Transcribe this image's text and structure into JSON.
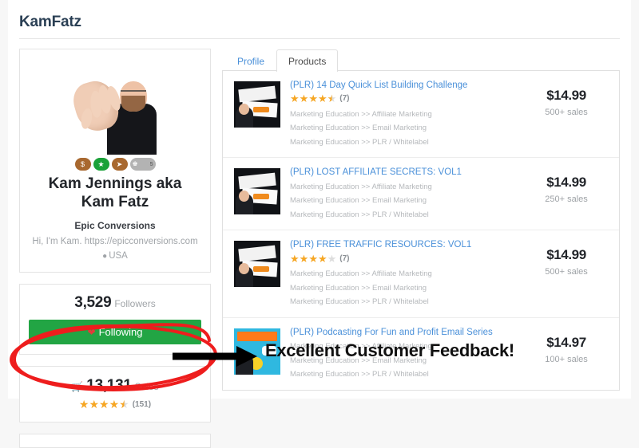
{
  "page": {
    "title": "KamFatz"
  },
  "profile": {
    "avatar_alt": "profile-photo",
    "badges": [
      {
        "name": "dollar-badge",
        "glyph": "$",
        "color": "#a8682f"
      },
      {
        "name": "star-badge",
        "glyph": "★",
        "color": "#1ba239"
      },
      {
        "name": "rocket-badge",
        "glyph": "➤",
        "color": "#a8682f"
      },
      {
        "name": "trophy-badge",
        "glyph": "♜",
        "color": "#b3b3b3",
        "count": "5"
      }
    ],
    "name": "Kam Jennings aka Kam Fatz",
    "company": "Epic Conversions",
    "bio": "Hi, I'm Kam. https://epicconversions.com",
    "location": "USA"
  },
  "followers": {
    "count": "3,529",
    "label": "Followers",
    "button_label": "Following"
  },
  "sales": {
    "count": "13,131",
    "label": "Sales",
    "rating": 4.5,
    "rating_count": "(151)"
  },
  "tabs": [
    {
      "label": "Profile",
      "active": false
    },
    {
      "label": "Products",
      "active": true
    }
  ],
  "products": [
    {
      "title": "(PLR) 14 Day Quick List Building Challenge",
      "rating": 4.5,
      "rating_count": "(7)",
      "categories": [
        "Marketing Education >> Affiliate Marketing",
        "Marketing Education >> Email Marketing",
        "Marketing Education >> PLR / Whitelabel"
      ],
      "price": "$14.99",
      "sales": "500+ sales",
      "thumb": "dark"
    },
    {
      "title": "(PLR) LOST AFFILIATE SECRETS: VOL1",
      "rating": null,
      "rating_count": "",
      "categories": [
        "Marketing Education >> Affiliate Marketing",
        "Marketing Education >> Email Marketing",
        "Marketing Education >> PLR / Whitelabel"
      ],
      "price": "$14.99",
      "sales": "250+ sales",
      "thumb": "dark"
    },
    {
      "title": "(PLR) FREE TRAFFIC RESOURCES: VOL1",
      "rating": 4,
      "rating_count": "(7)",
      "categories": [
        "Marketing Education >> Affiliate Marketing",
        "Marketing Education >> Email Marketing",
        "Marketing Education >> PLR / Whitelabel"
      ],
      "price": "$14.99",
      "sales": "500+ sales",
      "thumb": "dark"
    },
    {
      "title": "(PLR) Podcasting For Fun and Profit Email Series",
      "rating": null,
      "rating_count": "",
      "categories": [
        "Marketing Education >> Affiliate Marketing",
        "Marketing Education >> Email Marketing",
        "Marketing Education >> PLR / Whitelabel"
      ],
      "price": "$14.97",
      "sales": "100+ sales",
      "thumb": "blue"
    }
  ],
  "annotation": {
    "text": "Excellent Customer Feedback!",
    "highlight_color": "#ee1d1d",
    "arrow_color": "#000000"
  }
}
